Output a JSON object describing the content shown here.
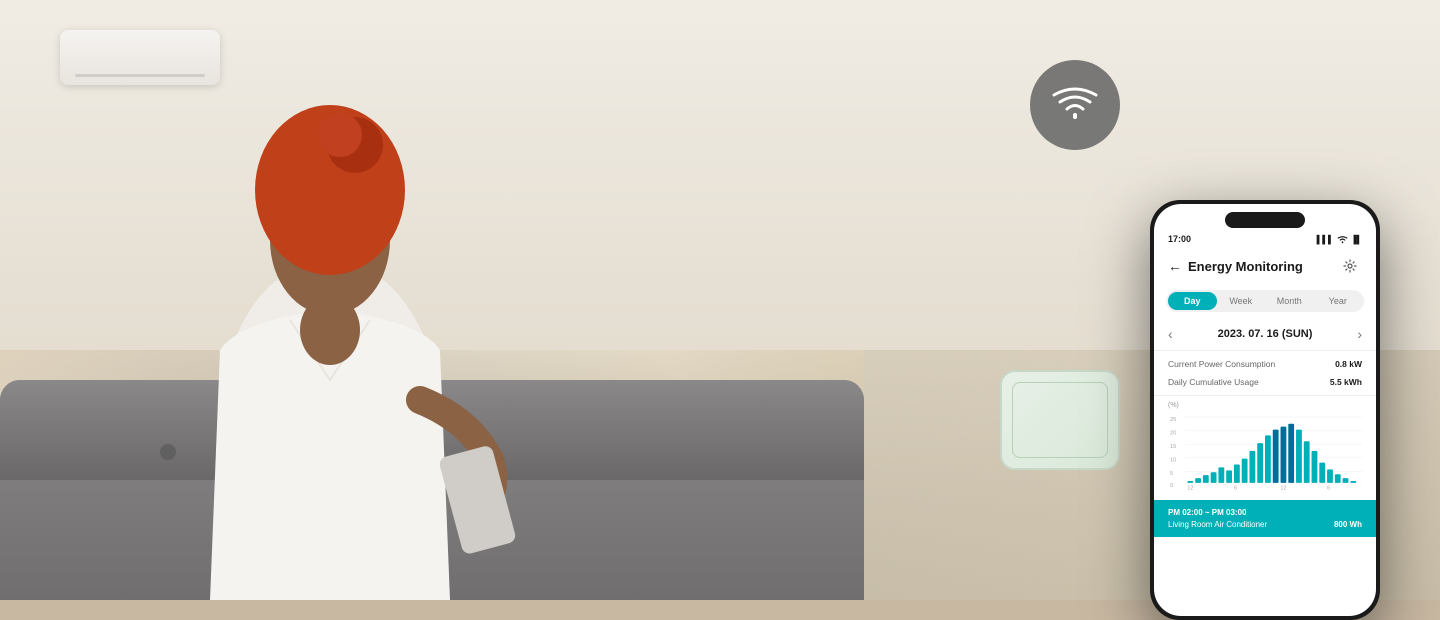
{
  "scene": {
    "wifi_icon": "wifi",
    "wifi_bg": "#666666"
  },
  "phone": {
    "status_time": "17:00",
    "status_signal": "▌▌▌",
    "status_wifi": "wifi",
    "status_battery": "▐",
    "header": {
      "back_label": "←",
      "title": "Energy Monitoring",
      "settings_icon": "⚙"
    },
    "tabs": [
      {
        "label": "Day",
        "active": true
      },
      {
        "label": "Week",
        "active": false
      },
      {
        "label": "Month",
        "active": false
      },
      {
        "label": "Year",
        "active": false
      }
    ],
    "date_nav": {
      "prev_arrow": "‹",
      "date": "2023. 07. 16 (SUN)",
      "next_arrow": "›"
    },
    "stats": [
      {
        "label": "Current Power Consumption",
        "value": "0.8 kW"
      },
      {
        "label": "Daily Cumulative Usage",
        "value": "5.5 kWh"
      }
    ],
    "chart": {
      "y_label": "(%)",
      "y_values": [
        "25",
        "20",
        "15",
        "10",
        "5",
        "0"
      ],
      "x_labels": [
        "12",
        "6",
        "12",
        "6"
      ],
      "bars": [
        1,
        2,
        3,
        4,
        6,
        5,
        7,
        9,
        12,
        15,
        18,
        20,
        22,
        24,
        20,
        16,
        12,
        8,
        6,
        4,
        3,
        2
      ],
      "bar_color": "#00b0b9",
      "peak_color": "#006e99"
    },
    "bottom_card": {
      "time": "PM 02:00 ~ PM 03:00",
      "device": "Living Room Air Conditioner",
      "watt": "800 Wh",
      "bg_color": "#00b0b9"
    }
  }
}
